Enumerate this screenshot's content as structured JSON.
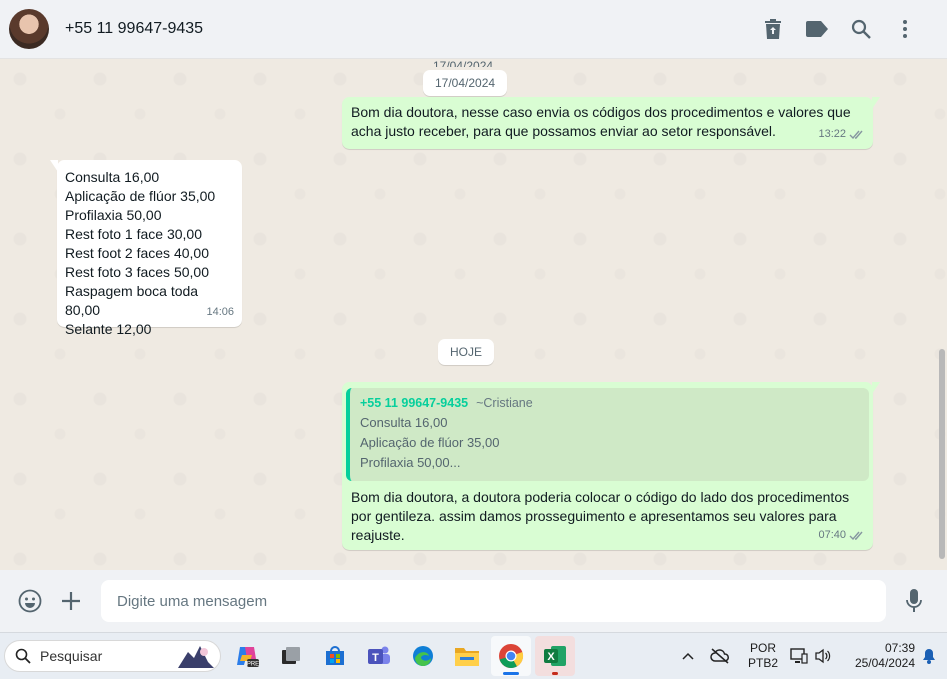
{
  "header": {
    "contact_name": "+55 11 99647-9435",
    "icons": [
      "delete-icon",
      "label-icon",
      "search-icon",
      "menu-icon"
    ]
  },
  "chat": {
    "date_ghost": "17/04/2024",
    "date_chip_1": "17/04/2024",
    "date_chip_2": "HOJE",
    "messages": [
      {
        "direction": "out",
        "lines": [
          "Bom dia doutora, nesse caso envia os códigos dos procedimentos e valores que",
          "acha justo receber, para que possamos enviar ao setor responsável."
        ],
        "time": "13:22"
      },
      {
        "direction": "in",
        "lines": [
          "Consulta 16,00",
          "Aplicação de flúor 35,00",
          "Profilaxia 50,00",
          "Rest foto 1 face 30,00",
          "Rest foot 2 faces 40,00",
          "Rest foto 3 faces 50,00",
          "Raspagem boca toda 80,00",
          "Selante 12,00"
        ],
        "time": "14:06"
      },
      {
        "direction": "out",
        "quote": {
          "author": "+55 11 99647-9435",
          "name": "~Cristiane",
          "lines": [
            "Consulta 16,00",
            "Aplicação de flúor 35,00",
            "Profilaxia 50,00..."
          ]
        },
        "lines": [
          "Bom dia doutora, a doutora poderia colocar o código do lado dos procedimentos",
          "por gentileza. assim damos prosseguimento e apresentamos seu valores para",
          "reajuste."
        ],
        "time": "07:40"
      }
    ]
  },
  "composer": {
    "placeholder": "Digite uma mensagem",
    "value": ""
  },
  "taskbar": {
    "search_label": "Pesquisar",
    "apps": [
      "copilot-icon",
      "task-view-icon",
      "store-icon",
      "teams-icon",
      "edge-icon",
      "file-explorer-icon",
      "chrome-icon",
      "excel-icon"
    ],
    "language_top": "POR",
    "language_bottom": "PTB2",
    "time": "07:39",
    "date": "25/04/2024"
  },
  "colors": {
    "outgoing_bubble": "#d9fdd3",
    "incoming_bubble": "#ffffff",
    "quote_accent": "#06cf9c",
    "read_ticks": "#8696a0"
  }
}
